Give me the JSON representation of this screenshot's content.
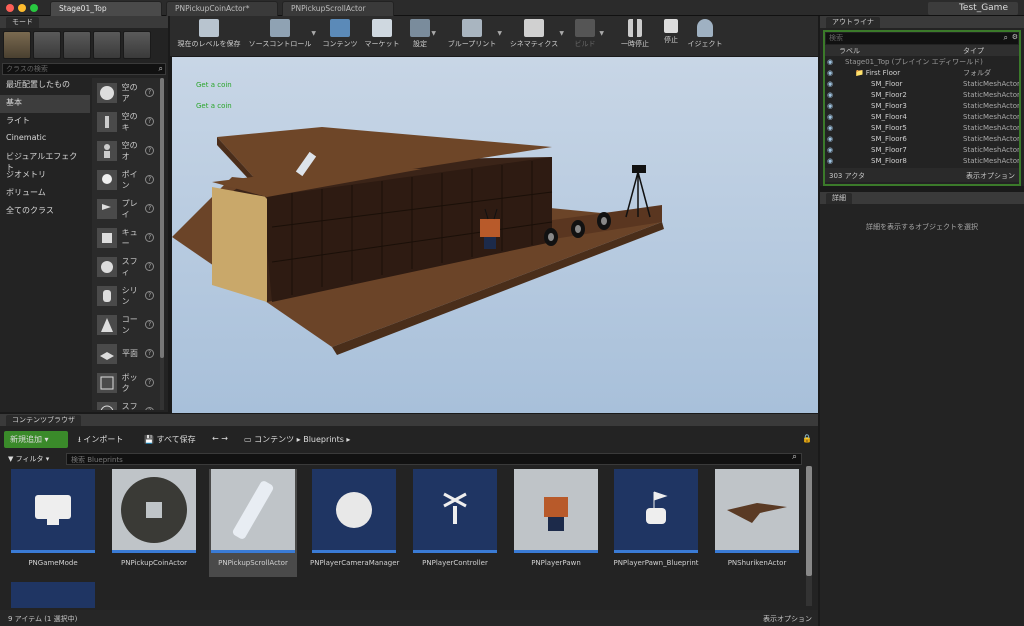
{
  "app": {
    "tabs": [
      "Stage01_Top",
      "PNPickupCoinActor*",
      "PNPickupScrollActor"
    ],
    "app_name": "Test_Game"
  },
  "modes": {
    "title": "モード",
    "search_placeholder": "クラスの検索",
    "categories": [
      "最近配置したもの",
      "基本",
      "ライト",
      "Cinematic",
      "ビジュアルエフェクト",
      "ジオメトリ",
      "ボリューム",
      "全てのクラス"
    ],
    "items": [
      "空のア",
      "空のキ",
      "空のオ",
      "ポイン",
      "プレイ",
      "キュー",
      "スフィ",
      "シリン",
      "コーン",
      "平面",
      "ボック",
      "スフィ"
    ]
  },
  "toolbar": {
    "buttons": [
      "現在のレベルを保存",
      "ソースコントロール",
      "コンテンツ",
      "マーケット",
      "設定",
      "ブループリント",
      "シネマティクス",
      "ビルド",
      "一時停止",
      "停止",
      "イジェクト"
    ]
  },
  "viewport": {
    "messages": [
      "Get a coin",
      "Get a coin"
    ]
  },
  "outliner": {
    "title": "アウトライナ",
    "search_placeholder": "検索",
    "col_label": "ラベル",
    "col_type": "タイプ",
    "rows": [
      {
        "label": "Stage01_Top (プレイイン エディワールド)",
        "type": ""
      },
      {
        "label": "First Floor",
        "type": "フォルダ"
      },
      {
        "label": "SM_Floor",
        "type": "StaticMeshActor"
      },
      {
        "label": "SM_Floor2",
        "type": "StaticMeshActor"
      },
      {
        "label": "SM_Floor3",
        "type": "StaticMeshActor"
      },
      {
        "label": "SM_Floor4",
        "type": "StaticMeshActor"
      },
      {
        "label": "SM_Floor5",
        "type": "StaticMeshActor"
      },
      {
        "label": "SM_Floor6",
        "type": "StaticMeshActor"
      },
      {
        "label": "SM_Floor7",
        "type": "StaticMeshActor"
      },
      {
        "label": "SM_Floor8",
        "type": "StaticMeshActor"
      }
    ],
    "count": "303 アクタ",
    "view_options": "表示オプション"
  },
  "details": {
    "title": "詳細",
    "empty_text": "詳細を表示するオブジェクトを選択"
  },
  "content_browser": {
    "title": "コンテンツブラウザ",
    "add_new": "新規追加",
    "import": "インポート",
    "save_all": "すべて保存",
    "path": [
      "コンテンツ",
      "Blueprints"
    ],
    "filter": "フィルタ",
    "search_placeholder": "検索 Blueprints",
    "assets": [
      "PNGameMode",
      "PNPickupCoinActor",
      "PNPickupScrollActor",
      "PNPlayerCameraManager",
      "PNPlayerController",
      "PNPlayerPawn",
      "PNPlayerPawn_Blueprint",
      "PNShurikenActor"
    ],
    "status": "9 アイテム (1 選択中)",
    "view_options": "表示オプション"
  }
}
